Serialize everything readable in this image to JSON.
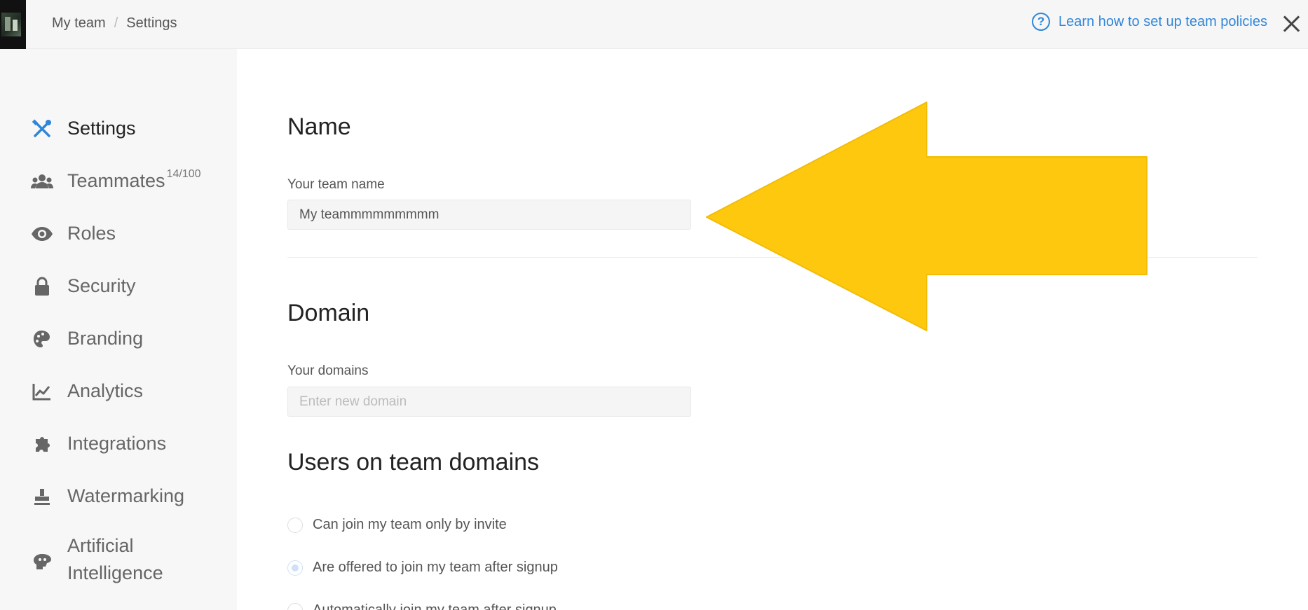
{
  "header": {
    "breadcrumb": [
      "My team",
      "Settings"
    ],
    "breadcrumb_separator": "/",
    "help_icon_glyph": "?",
    "help_link": "Learn how to set up team policies"
  },
  "sidebar": {
    "items": [
      {
        "label": "Settings",
        "icon": "tools-icon",
        "active": true
      },
      {
        "label": "Teammates",
        "icon": "people-icon",
        "badge": "14/100"
      },
      {
        "label": "Roles",
        "icon": "eye-icon"
      },
      {
        "label": "Security",
        "icon": "lock-icon"
      },
      {
        "label": "Branding",
        "icon": "palette-icon"
      },
      {
        "label": "Analytics",
        "icon": "chart-icon"
      },
      {
        "label": "Integrations",
        "icon": "puzzle-icon"
      },
      {
        "label": "Watermarking",
        "icon": "stamp-icon"
      },
      {
        "label_line1": "Artificial",
        "label_line2": "Intelligence",
        "icon": "ai-icon"
      }
    ]
  },
  "main": {
    "name_section": {
      "title": "Name",
      "label": "Your team name",
      "value": "My teammmmmmmmm"
    },
    "domain_section": {
      "title": "Domain",
      "label": "Your domains",
      "placeholder": "Enter new domain"
    },
    "users_section": {
      "title": "Users on team domains",
      "options": [
        {
          "label": "Can join my team only by invite",
          "checked": false
        },
        {
          "label": "Are offered to join my team after signup",
          "checked": true
        },
        {
          "label": "Automatically join my team after signup",
          "checked": false
        }
      ]
    }
  },
  "colors": {
    "accent": "#2f86d9",
    "arrow": "#fdc80d"
  }
}
